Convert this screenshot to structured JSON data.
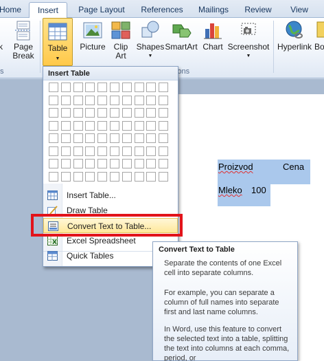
{
  "tabs": [
    {
      "label": "Home",
      "active": false
    },
    {
      "label": "Insert",
      "active": true
    },
    {
      "label": "Page Layout",
      "active": false
    },
    {
      "label": "References",
      "active": false
    },
    {
      "label": "Mailings",
      "active": false
    },
    {
      "label": "Review",
      "active": false
    },
    {
      "label": "View",
      "active": false
    }
  ],
  "ribbon": {
    "buttons": {
      "partial_label_1": "k",
      "page_break": "Page Break",
      "page_break_l1": "Page",
      "page_break_l2": "Break",
      "table": "Table",
      "picture": "Picture",
      "clip_art_l1": "Clip",
      "clip_art_l2": "Art",
      "shapes": "Shapes",
      "smartart": "SmartArt",
      "chart": "Chart",
      "screenshot": "Screenshot",
      "hyperlink": "Hyperlink",
      "bookmark": "Bo"
    },
    "groups": {
      "partial_left": "s",
      "illustrations": "ions"
    }
  },
  "dropdown": {
    "header": "Insert Table",
    "grid": {
      "rows": 8,
      "cols": 10
    },
    "items": [
      {
        "label": "Insert Table...",
        "icon": "insert-table-icon"
      },
      {
        "label": "Draw Table",
        "icon": "draw-table-icon"
      },
      {
        "label": "Convert Text to Table...",
        "icon": "convert-text-table-icon",
        "highlighted": true
      },
      {
        "label": "Excel Spreadsheet",
        "icon": "excel-spreadsheet-icon"
      },
      {
        "label": "Quick Tables",
        "icon": "quick-tables-icon"
      }
    ]
  },
  "document": {
    "row1_col1": "Proizvod",
    "row1_col2": "Cena",
    "row2_col1": "Mleko",
    "row2_col2": "100"
  },
  "tooltip": {
    "title": "Convert Text to Table",
    "p1": "Separate the contents of one Excel cell into separate columns.",
    "p2": "For example, you can separate a column of full names into separate first and last name columns.",
    "p3": "In Word, use this feature to convert the selected text into a table, splitting the text into columns at each comma, period, or"
  },
  "colors": {
    "accent_highlight": "#ffe89a",
    "red_annotation": "#e2131a",
    "selection": "#aac8ec"
  }
}
